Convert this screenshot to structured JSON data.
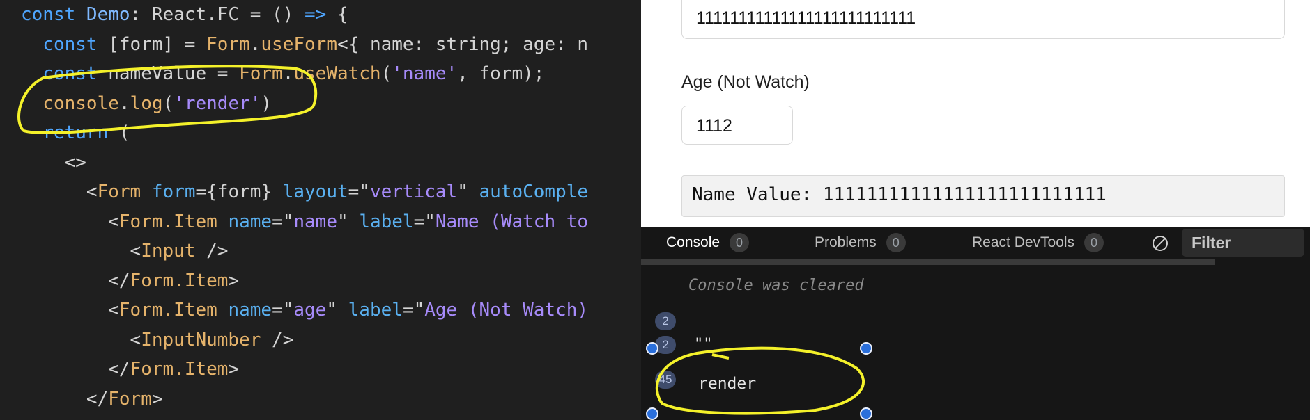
{
  "code_lines": [
    [
      [
        "kw",
        "const "
      ],
      [
        "type",
        "Demo"
      ],
      [
        "",
        "∶ React.FC = () "
      ],
      [
        "kw",
        "=> "
      ],
      [
        "",
        "{"
      ]
    ],
    [
      [
        "",
        "  "
      ],
      [
        "kw",
        "const "
      ],
      [
        "",
        "[form] = "
      ],
      [
        "fn",
        "Form"
      ],
      [
        "",
        ". "
      ],
      [
        "fn",
        "useForm"
      ],
      [
        "",
        "<{ name: string; age: n"
      ]
    ],
    [
      [
        "",
        "  "
      ],
      [
        "kw",
        "const "
      ],
      [
        "",
        "nameValue = "
      ],
      [
        "fn",
        "Form"
      ],
      [
        "",
        "."
      ],
      [
        "fn",
        "useWatch"
      ],
      [
        "",
        "("
      ],
      [
        "str",
        "'name'"
      ],
      [
        "",
        ", form);"
      ]
    ],
    [
      [
        "",
        "  "
      ],
      [
        "fn",
        "console"
      ],
      [
        "",
        "."
      ],
      [
        "fn",
        "log"
      ],
      [
        "",
        "("
      ],
      [
        "str",
        "'render'"
      ],
      [
        "",
        ")"
      ]
    ],
    [
      [
        "",
        "  "
      ],
      [
        "kw",
        "return "
      ],
      [
        "",
        "("
      ]
    ],
    [
      [
        "",
        "    <>"
      ]
    ],
    [
      [
        "",
        "      <"
      ],
      [
        "tag",
        "Form "
      ],
      [
        "attr",
        "form"
      ],
      [
        "",
        "={form} "
      ],
      [
        "attr",
        "layout"
      ],
      [
        "",
        "=\""
      ],
      [
        "str",
        "vertical"
      ],
      [
        "",
        "\" "
      ],
      [
        "attr",
        "autoComple"
      ]
    ],
    [
      [
        "",
        "        <"
      ],
      [
        "tag",
        "Form.Item "
      ],
      [
        "attr",
        "name"
      ],
      [
        "",
        "=\""
      ],
      [
        "str",
        "name"
      ],
      [
        "",
        "\" "
      ],
      [
        "attr",
        "label"
      ],
      [
        "",
        "=\""
      ],
      [
        "str",
        "Name (Watch to"
      ]
    ],
    [
      [
        "",
        "          <"
      ],
      [
        "tag",
        "Input "
      ],
      [
        "",
        "/>"
      ]
    ],
    [
      [
        "",
        "        </"
      ],
      [
        "tag",
        "Form.Item"
      ],
      [
        "",
        ">"
      ]
    ],
    [
      [
        "",
        "        <"
      ],
      [
        "tag",
        "Form.Item "
      ],
      [
        "attr",
        "name"
      ],
      [
        "",
        "=\""
      ],
      [
        "str",
        "age"
      ],
      [
        "",
        "\" "
      ],
      [
        "attr",
        "label"
      ],
      [
        "",
        "=\""
      ],
      [
        "str",
        "Age (Not Watch)"
      ]
    ],
    [
      [
        "",
        "          <"
      ],
      [
        "tag",
        "InputNumber "
      ],
      [
        "",
        "/>"
      ]
    ],
    [
      [
        "",
        "        </"
      ],
      [
        "tag",
        "Form.Item"
      ],
      [
        "",
        ">"
      ]
    ],
    [
      [
        "",
        "      </"
      ],
      [
        "tag",
        "Form"
      ],
      [
        "",
        ">"
      ]
    ]
  ],
  "preview": {
    "name_input_value": "11111111111111111111111111",
    "age_label": "Age (Not Watch)",
    "age_input_value": "1112",
    "name_value_text": "Name Value: 11111111111111111111111111"
  },
  "panel": {
    "tabs": [
      {
        "label": "Console",
        "count": "0"
      },
      {
        "label": "Problems",
        "count": "0"
      },
      {
        "label": "React DevTools",
        "count": "0"
      }
    ],
    "filter_placeholder": "Filter",
    "messages": {
      "cleared": "Console was cleared",
      "row1_count": "2",
      "row2_count": "2",
      "row2_text": "\"\"",
      "row3_count": "45",
      "row3_text": "render"
    }
  },
  "colors": {
    "annotation": "#f4f12a",
    "editor_bg": "#1f1f1f"
  }
}
